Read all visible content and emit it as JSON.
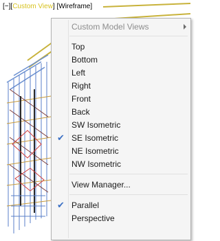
{
  "viewport": {
    "label_prefix": "[−][",
    "label_view": "Custom View",
    "label_style": "] [Wireframe]"
  },
  "menu": {
    "header": "Custom Model Views",
    "views": [
      "Top",
      "Bottom",
      "Left",
      "Right",
      "Front",
      "Back",
      "SW Isometric",
      "SE Isometric",
      "NE Isometric",
      "NW Isometric"
    ],
    "view_manager": "View Manager...",
    "projection": [
      "Parallel",
      "Perspective"
    ],
    "checked_view": "SE Isometric",
    "checked_projection": "Parallel"
  }
}
